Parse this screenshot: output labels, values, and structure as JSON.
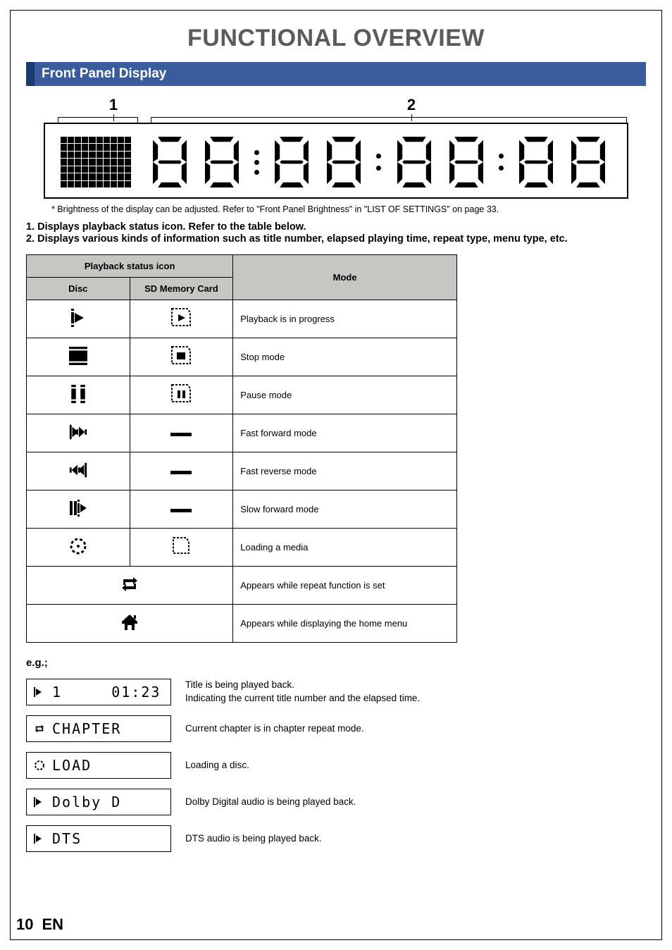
{
  "page": {
    "title": "FUNCTIONAL OVERVIEW",
    "number": "10",
    "lang": "EN"
  },
  "section": {
    "heading": "Front Panel Display"
  },
  "figure": {
    "label1": "1",
    "label2": "2"
  },
  "note": "* Brightness of the display can be adjusted. Refer to \"Front Panel Brightness\" in \"LIST OF SETTINGS\" on page 33.",
  "legend": {
    "item1": "1.  Displays playback status icon. Refer to the table below.",
    "item2": "2.  Displays various kinds of information such as title number, elapsed playing time, repeat type, menu type, etc."
  },
  "table": {
    "headers": {
      "playback": "Playback status icon",
      "disc": "Disc",
      "sd": "SD Memory Card",
      "mode": "Mode"
    },
    "rows": [
      {
        "mode": "Playback is in progress"
      },
      {
        "mode": "Stop mode"
      },
      {
        "mode": "Pause mode"
      },
      {
        "mode": "Fast forward mode"
      },
      {
        "mode": "Fast reverse mode"
      },
      {
        "mode": "Slow forward mode"
      },
      {
        "mode": "Loading a media"
      },
      {
        "mode": "Appears while repeat function is set"
      },
      {
        "mode": "Appears while displaying the home menu"
      }
    ]
  },
  "examples": {
    "heading": "e.g.;",
    "items": [
      {
        "text": "1     01:23",
        "desc": "Title is being played back.\nIndicating the current title number and the elapsed time."
      },
      {
        "text": "CHAPTER",
        "desc": "Current chapter is in chapter repeat mode."
      },
      {
        "text": "LOAD",
        "desc": "Loading a disc."
      },
      {
        "text": "Dolby D",
        "desc": "Dolby Digital audio is being played back."
      },
      {
        "text": "DTS",
        "desc": "DTS audio is being played back."
      }
    ]
  }
}
